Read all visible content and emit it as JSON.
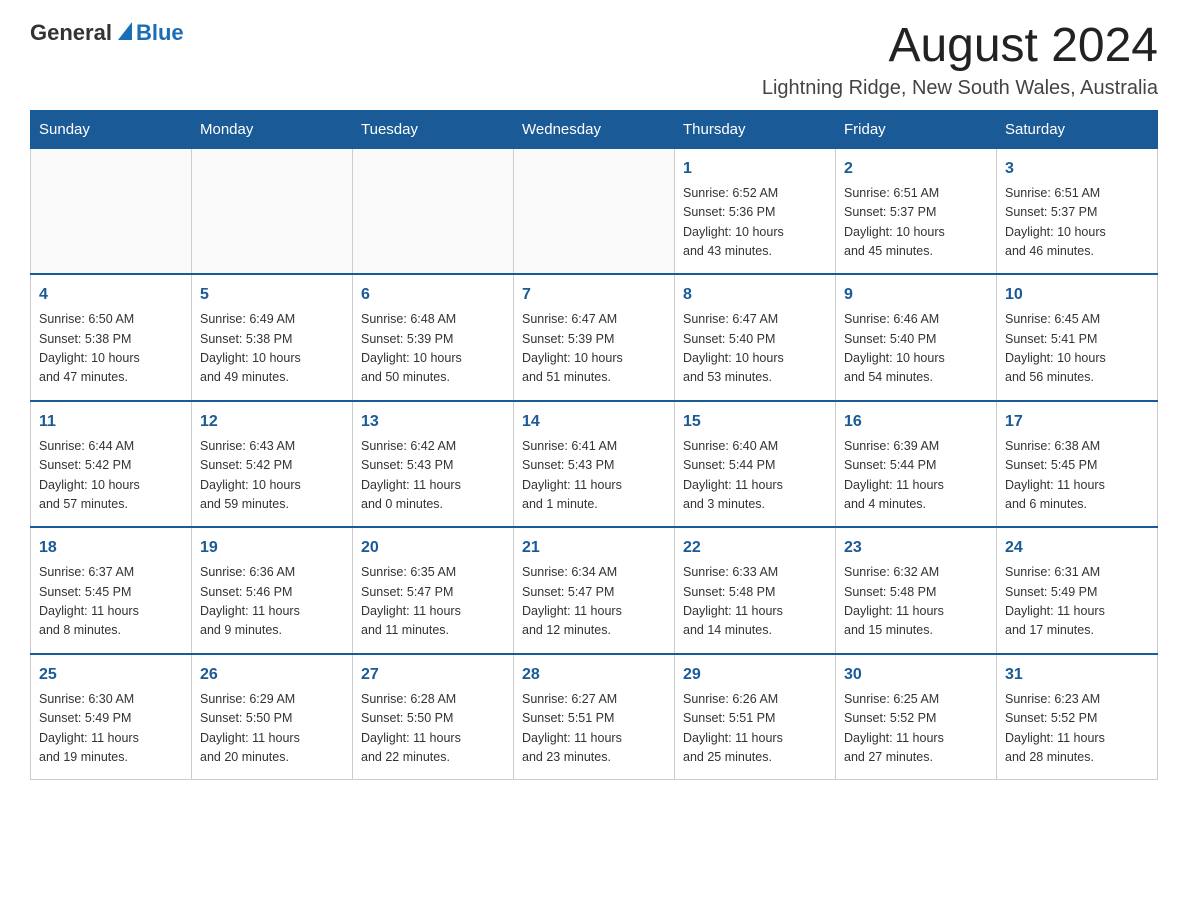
{
  "header": {
    "logo_general": "General",
    "logo_blue": "Blue",
    "month_title": "August 2024",
    "location": "Lightning Ridge, New South Wales, Australia"
  },
  "weekdays": [
    "Sunday",
    "Monday",
    "Tuesday",
    "Wednesday",
    "Thursday",
    "Friday",
    "Saturday"
  ],
  "weeks": [
    [
      {
        "day": "",
        "info": ""
      },
      {
        "day": "",
        "info": ""
      },
      {
        "day": "",
        "info": ""
      },
      {
        "day": "",
        "info": ""
      },
      {
        "day": "1",
        "info": "Sunrise: 6:52 AM\nSunset: 5:36 PM\nDaylight: 10 hours\nand 43 minutes."
      },
      {
        "day": "2",
        "info": "Sunrise: 6:51 AM\nSunset: 5:37 PM\nDaylight: 10 hours\nand 45 minutes."
      },
      {
        "day": "3",
        "info": "Sunrise: 6:51 AM\nSunset: 5:37 PM\nDaylight: 10 hours\nand 46 minutes."
      }
    ],
    [
      {
        "day": "4",
        "info": "Sunrise: 6:50 AM\nSunset: 5:38 PM\nDaylight: 10 hours\nand 47 minutes."
      },
      {
        "day": "5",
        "info": "Sunrise: 6:49 AM\nSunset: 5:38 PM\nDaylight: 10 hours\nand 49 minutes."
      },
      {
        "day": "6",
        "info": "Sunrise: 6:48 AM\nSunset: 5:39 PM\nDaylight: 10 hours\nand 50 minutes."
      },
      {
        "day": "7",
        "info": "Sunrise: 6:47 AM\nSunset: 5:39 PM\nDaylight: 10 hours\nand 51 minutes."
      },
      {
        "day": "8",
        "info": "Sunrise: 6:47 AM\nSunset: 5:40 PM\nDaylight: 10 hours\nand 53 minutes."
      },
      {
        "day": "9",
        "info": "Sunrise: 6:46 AM\nSunset: 5:40 PM\nDaylight: 10 hours\nand 54 minutes."
      },
      {
        "day": "10",
        "info": "Sunrise: 6:45 AM\nSunset: 5:41 PM\nDaylight: 10 hours\nand 56 minutes."
      }
    ],
    [
      {
        "day": "11",
        "info": "Sunrise: 6:44 AM\nSunset: 5:42 PM\nDaylight: 10 hours\nand 57 minutes."
      },
      {
        "day": "12",
        "info": "Sunrise: 6:43 AM\nSunset: 5:42 PM\nDaylight: 10 hours\nand 59 minutes."
      },
      {
        "day": "13",
        "info": "Sunrise: 6:42 AM\nSunset: 5:43 PM\nDaylight: 11 hours\nand 0 minutes."
      },
      {
        "day": "14",
        "info": "Sunrise: 6:41 AM\nSunset: 5:43 PM\nDaylight: 11 hours\nand 1 minute."
      },
      {
        "day": "15",
        "info": "Sunrise: 6:40 AM\nSunset: 5:44 PM\nDaylight: 11 hours\nand 3 minutes."
      },
      {
        "day": "16",
        "info": "Sunrise: 6:39 AM\nSunset: 5:44 PM\nDaylight: 11 hours\nand 4 minutes."
      },
      {
        "day": "17",
        "info": "Sunrise: 6:38 AM\nSunset: 5:45 PM\nDaylight: 11 hours\nand 6 minutes."
      }
    ],
    [
      {
        "day": "18",
        "info": "Sunrise: 6:37 AM\nSunset: 5:45 PM\nDaylight: 11 hours\nand 8 minutes."
      },
      {
        "day": "19",
        "info": "Sunrise: 6:36 AM\nSunset: 5:46 PM\nDaylight: 11 hours\nand 9 minutes."
      },
      {
        "day": "20",
        "info": "Sunrise: 6:35 AM\nSunset: 5:47 PM\nDaylight: 11 hours\nand 11 minutes."
      },
      {
        "day": "21",
        "info": "Sunrise: 6:34 AM\nSunset: 5:47 PM\nDaylight: 11 hours\nand 12 minutes."
      },
      {
        "day": "22",
        "info": "Sunrise: 6:33 AM\nSunset: 5:48 PM\nDaylight: 11 hours\nand 14 minutes."
      },
      {
        "day": "23",
        "info": "Sunrise: 6:32 AM\nSunset: 5:48 PM\nDaylight: 11 hours\nand 15 minutes."
      },
      {
        "day": "24",
        "info": "Sunrise: 6:31 AM\nSunset: 5:49 PM\nDaylight: 11 hours\nand 17 minutes."
      }
    ],
    [
      {
        "day": "25",
        "info": "Sunrise: 6:30 AM\nSunset: 5:49 PM\nDaylight: 11 hours\nand 19 minutes."
      },
      {
        "day": "26",
        "info": "Sunrise: 6:29 AM\nSunset: 5:50 PM\nDaylight: 11 hours\nand 20 minutes."
      },
      {
        "day": "27",
        "info": "Sunrise: 6:28 AM\nSunset: 5:50 PM\nDaylight: 11 hours\nand 22 minutes."
      },
      {
        "day": "28",
        "info": "Sunrise: 6:27 AM\nSunset: 5:51 PM\nDaylight: 11 hours\nand 23 minutes."
      },
      {
        "day": "29",
        "info": "Sunrise: 6:26 AM\nSunset: 5:51 PM\nDaylight: 11 hours\nand 25 minutes."
      },
      {
        "day": "30",
        "info": "Sunrise: 6:25 AM\nSunset: 5:52 PM\nDaylight: 11 hours\nand 27 minutes."
      },
      {
        "day": "31",
        "info": "Sunrise: 6:23 AM\nSunset: 5:52 PM\nDaylight: 11 hours\nand 28 minutes."
      }
    ]
  ]
}
